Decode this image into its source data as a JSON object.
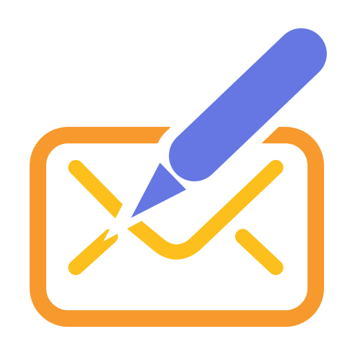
{
  "icon": {
    "semantic_name": "compose-mail-icon",
    "parts": [
      "envelope",
      "envelope-flap",
      "pen"
    ],
    "colors": {
      "background": "#ffffff",
      "envelope_frame": "#F7992D",
      "envelope_flap": "#FDBF1C",
      "pen_body": "#6677E4",
      "cutout": "#ffffff"
    }
  }
}
